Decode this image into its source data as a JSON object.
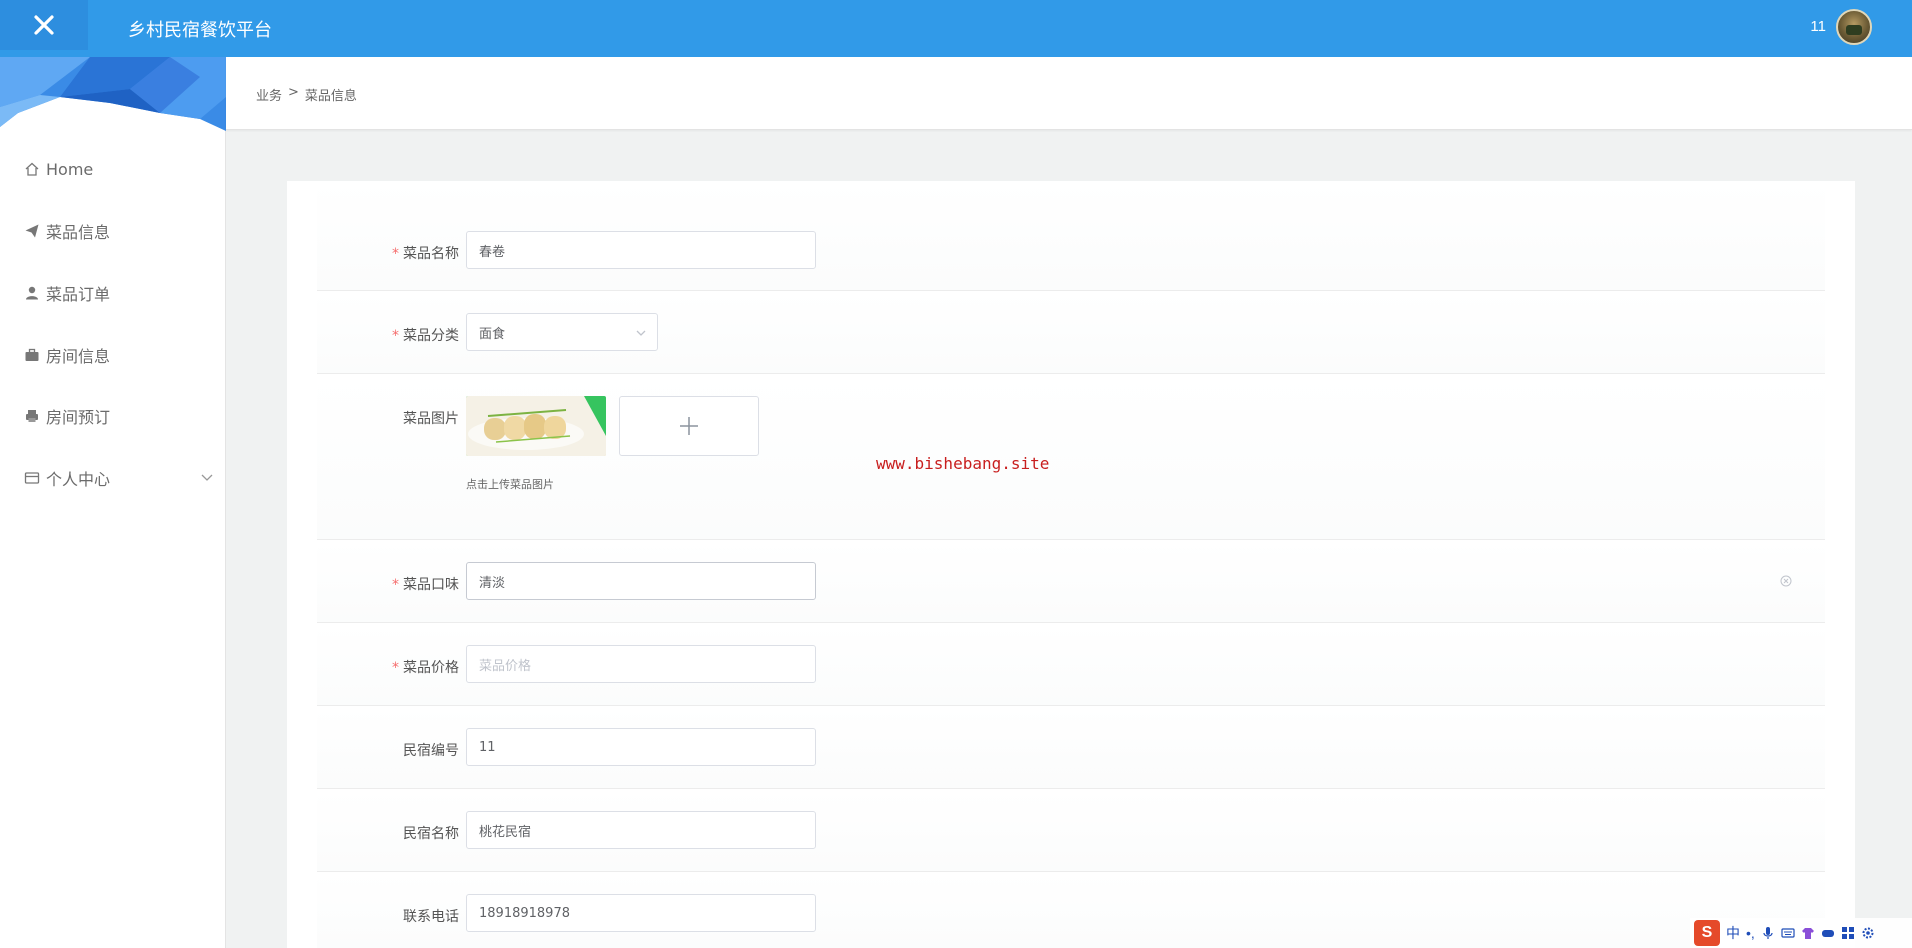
{
  "header": {
    "app_title": "乡村民宿餐饮平台",
    "user_name": "11"
  },
  "sidebar": {
    "items": [
      {
        "label": "Home",
        "icon": "home-icon"
      },
      {
        "label": "菜品信息",
        "icon": "paper-plane-icon"
      },
      {
        "label": "菜品订单",
        "icon": "user-icon"
      },
      {
        "label": "房间信息",
        "icon": "briefcase-icon"
      },
      {
        "label": "房间预订",
        "icon": "printer-icon"
      },
      {
        "label": "个人中心",
        "icon": "card-icon"
      }
    ]
  },
  "breadcrumb": {
    "parent": "业务",
    "separator": ">",
    "current": "菜品信息"
  },
  "form": {
    "dish_name": {
      "label": "菜品名称",
      "required": true,
      "value": "春卷"
    },
    "dish_category": {
      "label": "菜品分类",
      "required": true,
      "value": "面食"
    },
    "dish_image": {
      "label": "菜品图片",
      "hint": "点击上传菜品图片",
      "image": "spring-roll-thumbnail"
    },
    "dish_taste": {
      "label": "菜品口味",
      "required": true,
      "value": "清淡"
    },
    "dish_price": {
      "label": "菜品价格",
      "required": true,
      "placeholder": "菜品价格"
    },
    "homestay_id": {
      "label": "民宿编号",
      "value": "11"
    },
    "homestay_name": {
      "label": "民宿名称",
      "value": "桃花民宿"
    },
    "contact_phone": {
      "label": "联系电话",
      "value": "18918918978"
    }
  },
  "watermark": "www.bishebang.site",
  "ime_tray": {
    "mode": "中",
    "punct": "•,"
  },
  "colors": {
    "header": "#319ae8",
    "required": "#f56c6c",
    "watermark": "#c81e1e"
  }
}
